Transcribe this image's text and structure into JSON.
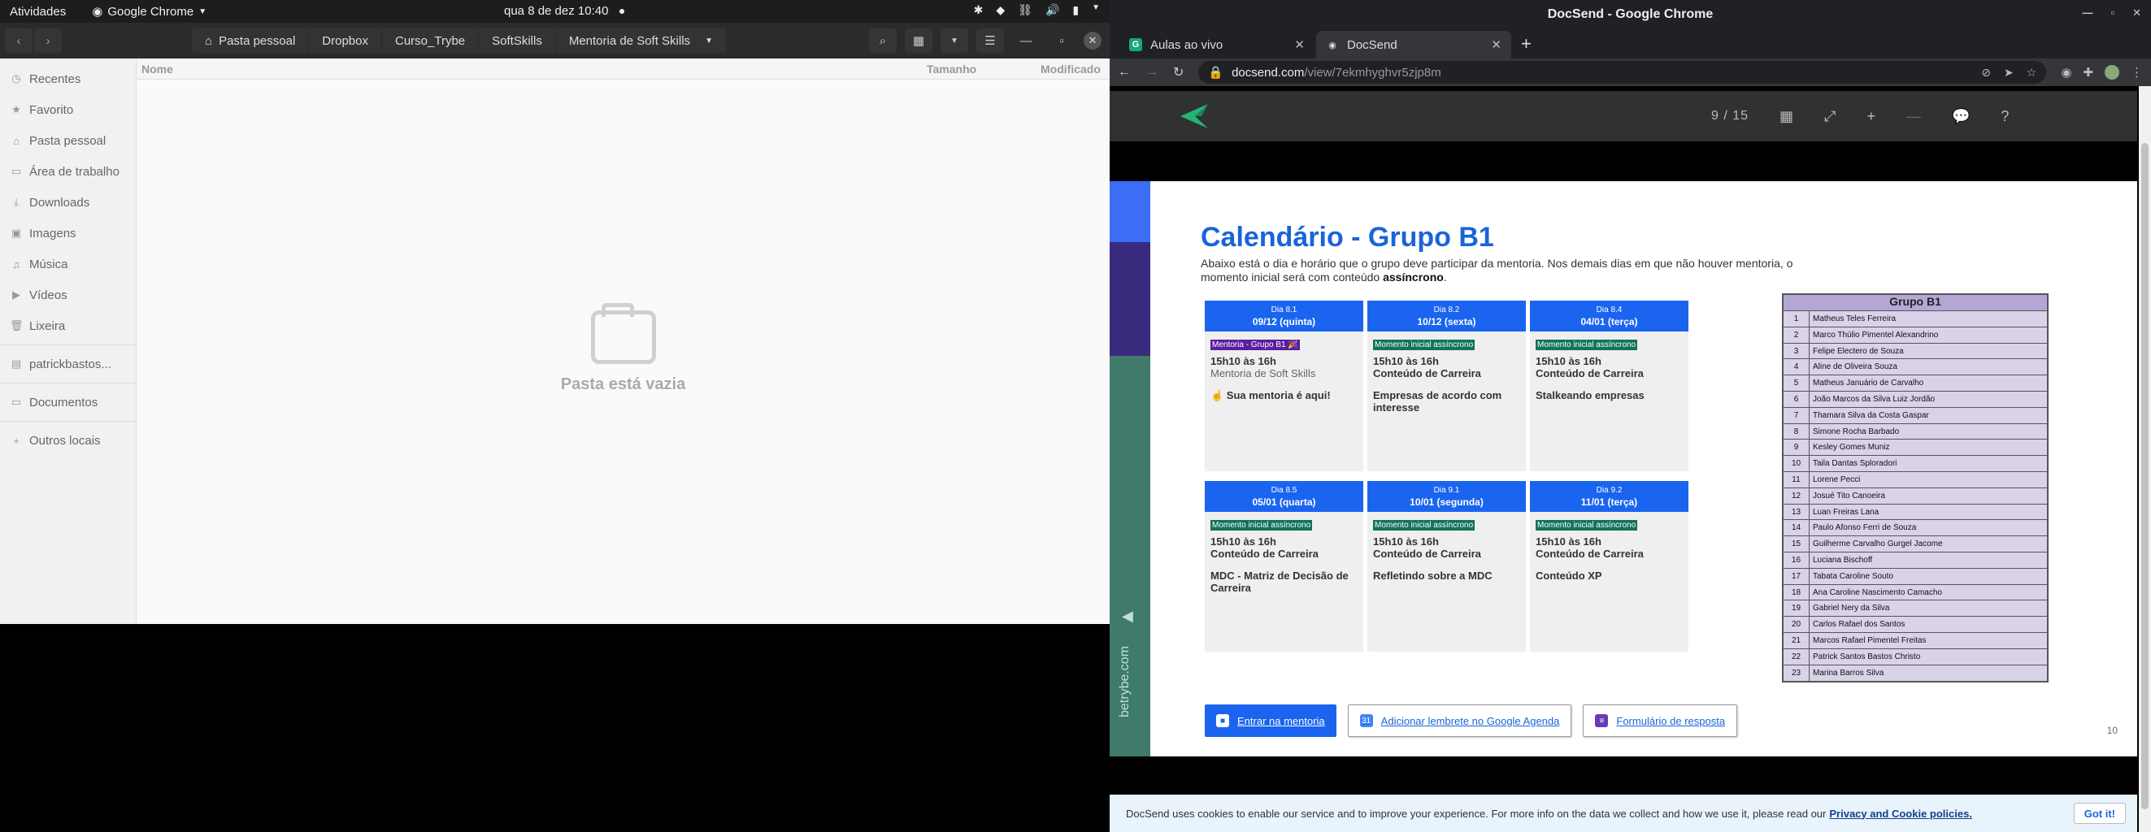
{
  "topbar": {
    "activities": "Atividades",
    "app": "Google Chrome",
    "clock": "qua 8 de dez  10:40"
  },
  "files": {
    "breadcrumbs": [
      "Pasta pessoal",
      "Dropbox",
      "Curso_Trybe",
      "SoftSkills",
      "Mentoria de Soft Skills"
    ],
    "sidebar": [
      {
        "label": "Recentes",
        "icon": "clock-icon"
      },
      {
        "label": "Favorito",
        "icon": "star-icon"
      },
      {
        "label": "Pasta pessoal",
        "icon": "home-icon"
      },
      {
        "label": "Área de trabalho",
        "icon": "desktop-icon"
      },
      {
        "label": "Downloads",
        "icon": "download-icon"
      },
      {
        "label": "Imagens",
        "icon": "image-icon"
      },
      {
        "label": "Música",
        "icon": "music-icon"
      },
      {
        "label": "Vídeos",
        "icon": "video-icon"
      },
      {
        "label": "Lixeira",
        "icon": "trash-icon"
      },
      {
        "label": "patrickbastos...",
        "icon": "drive-icon"
      },
      {
        "label": "Documentos",
        "icon": "folder-icon"
      },
      {
        "label": "Outros locais",
        "icon": "plus-icon"
      }
    ],
    "columns": {
      "name": "Nome",
      "size": "Tamanho",
      "modified": "Modificado"
    },
    "empty_message": "Pasta está vazia"
  },
  "chrome": {
    "window_title": "DocSend - Google Chrome",
    "tabs": [
      {
        "title": "Aulas ao vivo",
        "favicon": "G",
        "favicon_color": "#18a779",
        "active": false
      },
      {
        "title": "DocSend",
        "favicon": "◉",
        "favicon_color": "#dddddd",
        "active": true
      }
    ],
    "url_host": "docsend.com",
    "url_path": "/view/7ekmhyghvr5zjp8m"
  },
  "docsend": {
    "page_indicator": "9 / 15"
  },
  "slide": {
    "title": "Calendário - Grupo B1",
    "intro_text": "Abaixo está o dia e horário que o grupo deve participar da mentoria. Nos demais dias em que não houver mentoria, o momento inicial será com conteúdo ",
    "intro_bold": "assíncrono",
    "intro_end": ".",
    "side_text": "betrybe.com",
    "days": [
      {
        "label": "Dia 8.1",
        "date": "09/12 (quinta)",
        "tag": "Mentoria - Grupo B1 🎉",
        "tag_type": "purple",
        "time": "15h10 às 16h",
        "subtitle": "Mentoria de Soft Skills",
        "desc": "☝️ Sua mentoria é aqui!"
      },
      {
        "label": "Dia 8.2",
        "date": "10/12 (sexta)",
        "tag": "Momento inicial assíncrono",
        "tag_type": "green",
        "time": "15h10 às 16h",
        "subtitle": "Conteúdo de Carreira",
        "desc": "Empresas de acordo com interesse"
      },
      {
        "label": "Dia 8.4",
        "date": "04/01 (terça)",
        "tag": "Momento inicial assíncrono",
        "tag_type": "green",
        "time": "15h10 às 16h",
        "subtitle": "Conteúdo de Carreira",
        "desc": "Stalkeando empresas"
      },
      {
        "label": "Dia 8.5",
        "date": "05/01 (quarta)",
        "tag": "Momento inicial assíncrono",
        "tag_type": "green",
        "time": "15h10 às 16h",
        "subtitle": "Conteúdo de Carreira",
        "desc": "MDC - Matriz de Decisão de Carreira"
      },
      {
        "label": "Dia 9.1",
        "date": "10/01 (segunda)",
        "tag": "Momento inicial assíncrono",
        "tag_type": "green",
        "time": "15h10 às 16h",
        "subtitle": "Conteúdo de Carreira",
        "desc": "Refletindo sobre a MDC"
      },
      {
        "label": "Dia 9.2",
        "date": "11/01 (terça)",
        "tag": "Momento inicial assíncrono",
        "tag_type": "green",
        "time": "15h10 às 16h",
        "subtitle": "Conteúdo de Carreira",
        "desc": "Conteúdo XP"
      }
    ],
    "group": {
      "title": "Grupo B1",
      "members": [
        {
          "n": "1",
          "name": "Matheus Teles Ferreira"
        },
        {
          "n": "2",
          "name": "Marco Thúlio Pimentel Alexandrino"
        },
        {
          "n": "3",
          "name": "Felipe Electero de Souza"
        },
        {
          "n": "4",
          "name": "Aline de Oliveira Souza"
        },
        {
          "n": "5",
          "name": "Matheus Januário de Carvalho"
        },
        {
          "n": "6",
          "name": "João Marcos da Silva Luiz Jordão"
        },
        {
          "n": "7",
          "name": "Thamara Silva da Costa Gaspar"
        },
        {
          "n": "8",
          "name": "Simone Rocha Barbado"
        },
        {
          "n": "9",
          "name": "Kesley Gomes Muniz"
        },
        {
          "n": "10",
          "name": "Taila Dantas Sploradori"
        },
        {
          "n": "11",
          "name": "Lorene Pecci"
        },
        {
          "n": "12",
          "name": "Josué Tito Canoeira"
        },
        {
          "n": "13",
          "name": "Luan Freiras Lana"
        },
        {
          "n": "14",
          "name": "Paulo Afonso Ferri de Souza"
        },
        {
          "n": "15",
          "name": "Guilherme Carvalho Gurgel Jacome"
        },
        {
          "n": "16",
          "name": "Luciana Bischoff"
        },
        {
          "n": "17",
          "name": "Tabata Caroline Souto"
        },
        {
          "n": "18",
          "name": "Ana Caroline Nascimento Camacho"
        },
        {
          "n": "19",
          "name": "Gabriel Nery da Silva"
        },
        {
          "n": "20",
          "name": "Carlos Rafael dos Santos"
        },
        {
          "n": "21",
          "name": "Marcos Rafael Pimentel Freitas"
        },
        {
          "n": "22",
          "name": "Patrick Santos Bastos Christo"
        },
        {
          "n": "23",
          "name": "Marina Barros Silva"
        }
      ]
    },
    "buttons": {
      "enter": "Entrar na mentoria",
      "calendar": "Adicionar lembrete no Google Agenda",
      "form": "Formulário de resposta"
    },
    "page_number": "10"
  },
  "cookie": {
    "text": "DocSend uses cookies to enable our service and to improve your experience. For more info on the data we collect and how we use it, please read our",
    "link": "Privacy and Cookie policies.",
    "button": "Got it!"
  }
}
